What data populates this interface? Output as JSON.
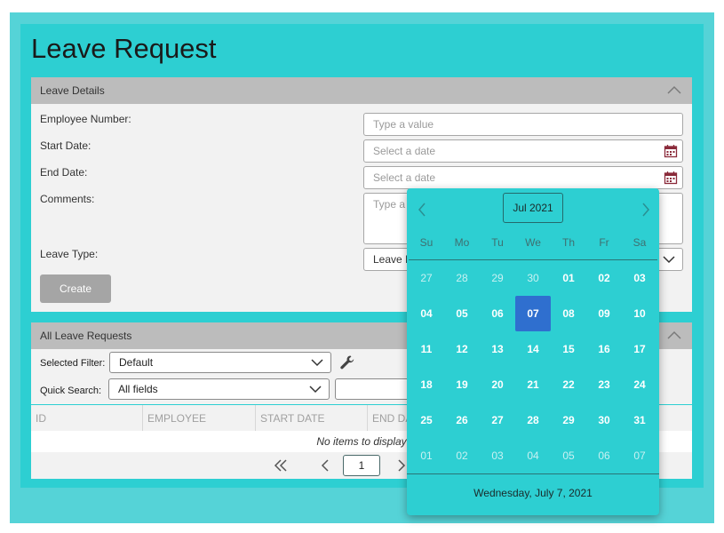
{
  "page": {
    "title": "Leave Request"
  },
  "details": {
    "header": "Leave Details",
    "employee_label": "Employee Number:",
    "employee_placeholder": "Type a value",
    "start_label": "Start Date:",
    "start_placeholder": "Select a date",
    "end_label": "End Date:",
    "end_placeholder": "Select a date",
    "comments_label": "Comments:",
    "comments_placeholder": "Type a",
    "leave_type_label": "Leave Type:",
    "leave_type_value": "Leave I",
    "create_button": "Create"
  },
  "requests": {
    "header": "All Leave Requests",
    "filter_label": "Selected Filter:",
    "filter_value": "Default",
    "search_label": "Quick Search:",
    "search_value": "All fields",
    "columns": [
      "ID",
      "EMPLOYEE NUMBER",
      "START DATE",
      "END DA"
    ],
    "empty_text": "No items to display",
    "page_number": "1"
  },
  "calendar": {
    "month_label": "Jul 2021",
    "weekdays": [
      "Su",
      "Mo",
      "Tu",
      "We",
      "Th",
      "Fr",
      "Sa"
    ],
    "weeks": [
      [
        "27",
        "28",
        "29",
        "30",
        "01",
        "02",
        "03"
      ],
      [
        "04",
        "05",
        "06",
        "07",
        "08",
        "09",
        "10"
      ],
      [
        "11",
        "12",
        "13",
        "14",
        "15",
        "16",
        "17"
      ],
      [
        "18",
        "19",
        "20",
        "21",
        "22",
        "23",
        "24"
      ],
      [
        "25",
        "26",
        "27",
        "28",
        "29",
        "30",
        "31"
      ],
      [
        "01",
        "02",
        "03",
        "04",
        "05",
        "06",
        "07"
      ]
    ],
    "selected_day": "07",
    "footer": "Wednesday, July 7, 2021"
  }
}
